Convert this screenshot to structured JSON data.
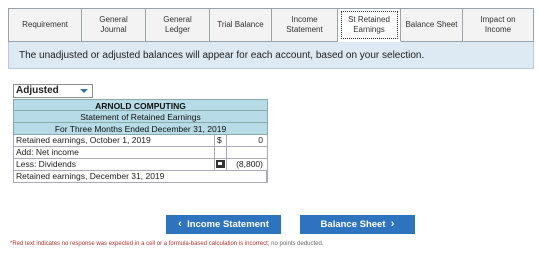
{
  "tabs": [
    {
      "label": "Requirement",
      "width": 74
    },
    {
      "label": "General\nJournal",
      "width": 64
    },
    {
      "label": "General\nLedger",
      "width": 64
    },
    {
      "label": "Trial Balance",
      "width": 62
    },
    {
      "label": "Income\nStatement",
      "width": 66
    },
    {
      "label": "St Retained\nEarnings",
      "width": 63,
      "active": true
    },
    {
      "label": "Balance Sheet",
      "width": 62
    },
    {
      "label": "Impact on\nIncome",
      "width": 71
    }
  ],
  "banner_text": "The unadjusted or adjusted balances will appear for each account, based on your selection.",
  "balance_select": {
    "value": "Adjusted"
  },
  "statement": {
    "company": "ARNOLD COMPUTING",
    "title": "Statement of Retained Earnings",
    "period": "For Three Months Ended December 31, 2019",
    "rows": [
      {
        "label": "Retained earnings, October 1, 2019",
        "currency": "$",
        "amount": "0"
      },
      {
        "label": "Add: Net income",
        "currency": "",
        "amount": ""
      },
      {
        "label": "Less: Dividends",
        "currency": "",
        "amount": "(8,800)",
        "flag": true
      },
      {
        "label": "Retained earnings, December 31, 2019",
        "currency": "",
        "amount": "",
        "noamt": true
      }
    ]
  },
  "nav": {
    "prev_label": "Income Statement",
    "next_label": "Balance Sheet",
    "prev_chevron": "‹",
    "next_chevron": "›"
  },
  "footnote": {
    "red": "*Red text indicates no response was expected in a cell or a formula-based calculation is incorrect;",
    "rest": " no points deducted."
  },
  "colors": {
    "accent": "#2e73bd",
    "header_fill": "#b7dce7",
    "banner_fill": "#dde9f3"
  }
}
